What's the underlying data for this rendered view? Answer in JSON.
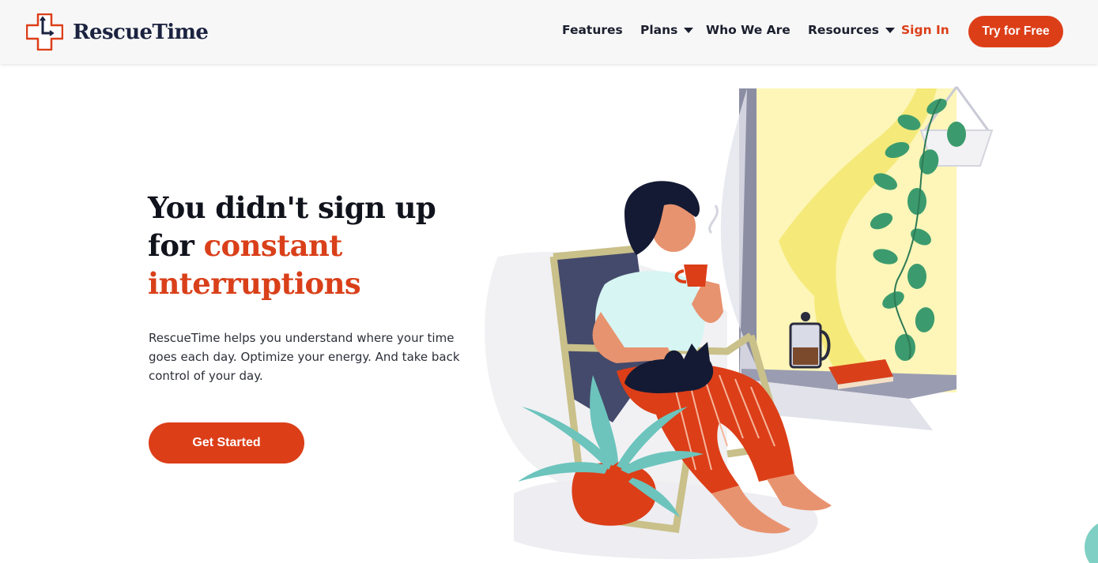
{
  "brand": {
    "name": "RescueTime"
  },
  "nav": {
    "features": "Features",
    "plans": "Plans",
    "who_we_are": "Who We Are",
    "resources": "Resources",
    "sign_in": "Sign In",
    "try_free": "Try for Free"
  },
  "hero": {
    "title_line1": "You didn't sign up",
    "title_for": "for ",
    "title_accent": "constant interruptions",
    "description": "RescueTime helps you understand where your time goes each day. Optimize your energy. And take back control of your day.",
    "cta": "Get Started"
  },
  "colors": {
    "accent": "#dc3e18",
    "heading": "#11131c",
    "header_bg": "#f7f7f7"
  }
}
